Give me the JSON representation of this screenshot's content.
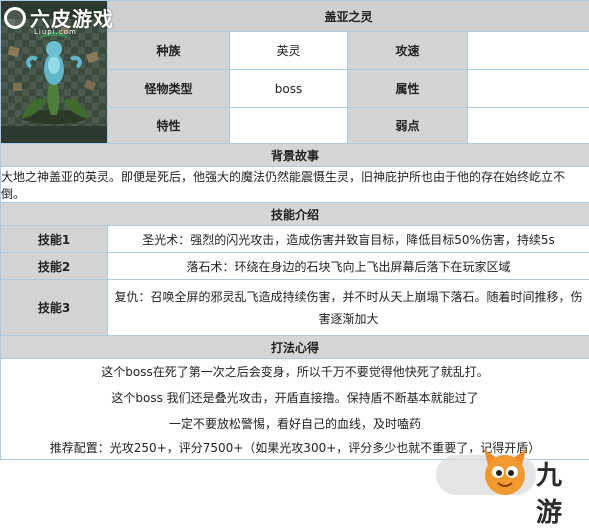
{
  "site_logo": {
    "name": "六皮游戏",
    "domain": "Liupi.com"
  },
  "title": "盖亚之灵",
  "attributes": {
    "race_label": "种族",
    "race_value": "英灵",
    "attack_speed_label": "攻速",
    "attack_speed_value": "",
    "monster_type_label": "怪物类型",
    "monster_type_value": "boss",
    "element_label": "属性",
    "element_value": "",
    "trait_label": "特性",
    "trait_value": "",
    "weakness_label": "弱点",
    "weakness_value": ""
  },
  "background": {
    "heading": "背景故事",
    "text": "大地之神盖亚的英灵。即便是死后，他强大的魔法仍然能震慑生灵，旧神庇护所也由于他的存在始终屹立不倒。"
  },
  "skills": {
    "heading": "技能介绍",
    "items": [
      {
        "name": "技能1",
        "desc": "圣光术：强烈的闪光攻击，造成伤害并致盲目标，降低目标50%伤害，持续5s"
      },
      {
        "name": "技能2",
        "desc": "落石术：环绕在身边的石块飞向上飞出屏幕后落下在玩家区域"
      },
      {
        "name": "技能3",
        "desc": "复仇：召唤全屏的邪灵乱飞造成持续伤害，并不时从天上崩塌下落石。随着时间推移，伤害逐渐加大"
      }
    ]
  },
  "tips": {
    "heading": "打法心得",
    "lines": [
      "这个boss在死了第一次之后会变身，所以千万不要觉得他快死了就乱打。",
      "这个boss 我们还是叠光攻击，开盾直接撸。保持盾不断基本就能过了",
      "一定不要放松警惕，看好自己的血线，及时嗑药",
      "推荐配置：光攻250+，评分7500+（如果光攻300+，评分多少也就不重要了，记得开盾）"
    ]
  },
  "watermark": {
    "text": "九游"
  }
}
